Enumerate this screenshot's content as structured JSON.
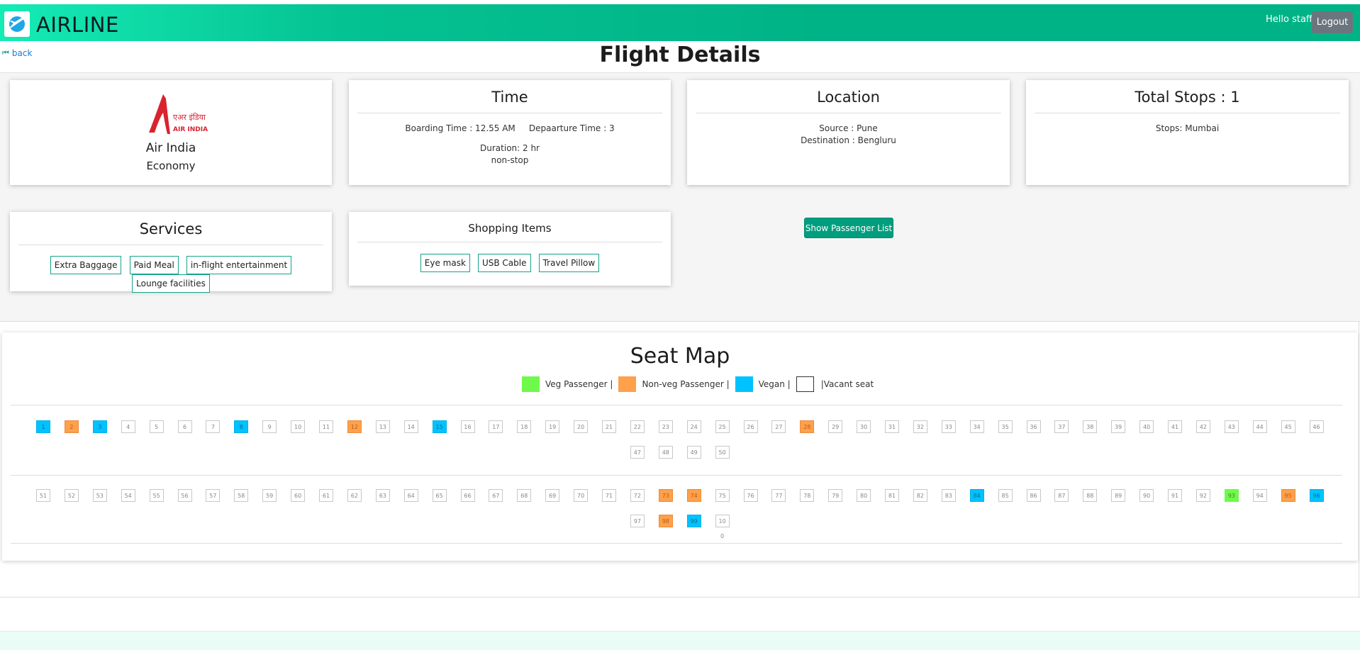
{
  "header": {
    "brand": "AIRLINE",
    "brand_icon": "airplane-icon",
    "greeting": "Hello staff",
    "logout_label": "Logout",
    "gradient_start": "#15ebb5",
    "gradient_end": "#00b386"
  },
  "nav": {
    "back_label": "back",
    "back_icon": "step-back-icon"
  },
  "page_title": "Flight Details",
  "airline_card": {
    "name": "Air India",
    "class": "Economy",
    "logo": "air-india-logo"
  },
  "time_card": {
    "title": "Time",
    "boarding": "Boarding Time : 12.55 AM",
    "departure": "Depaarture Time : 3",
    "duration": "Duration: 2 hr",
    "stop_type": "non-stop"
  },
  "location_card": {
    "title": "Location",
    "source": "Source : Pune",
    "destination": "Destination : Bengluru"
  },
  "stops_card": {
    "title": "Total Stops : 1",
    "stops": "Stops: Mumbai"
  },
  "services_card": {
    "title": "Services",
    "items": [
      "Extra Baggage",
      "Paid Meal",
      "in-flight entertainment",
      "Lounge facilities"
    ]
  },
  "shopping_card": {
    "title": "Shopping Items",
    "items": [
      "Eye mask",
      "USB Cable",
      "Travel Pillow"
    ]
  },
  "show_passenger_button": "Show Passenger List",
  "seat_map": {
    "title": "Seat Map",
    "legend": [
      {
        "label": "Veg Passenger |",
        "type": "veg"
      },
      {
        "label": "Non-veg Passenger |",
        "type": "nonveg"
      },
      {
        "label": "Vegan |",
        "type": "vegan"
      },
      {
        "label": "|Vacant seat",
        "type": "vacant"
      }
    ],
    "colors": {
      "veg": "#6ff94a",
      "nonveg": "#ffa04a",
      "vegan": "#00c2ff",
      "vacant": "#ffffff"
    },
    "seats": [
      {
        "n": "1",
        "t": "vegan"
      },
      {
        "n": "2",
        "t": "nonveg"
      },
      {
        "n": "3",
        "t": "vegan"
      },
      {
        "n": "4",
        "t": ""
      },
      {
        "n": "5",
        "t": ""
      },
      {
        "n": "6",
        "t": ""
      },
      {
        "n": "7",
        "t": ""
      },
      {
        "n": "8",
        "t": "vegan"
      },
      {
        "n": "9",
        "t": ""
      },
      {
        "n": "10",
        "t": ""
      },
      {
        "n": "11",
        "t": ""
      },
      {
        "n": "12",
        "t": "nonveg"
      },
      {
        "n": "13",
        "t": ""
      },
      {
        "n": "14",
        "t": ""
      },
      {
        "n": "15",
        "t": "vegan"
      },
      {
        "n": "16",
        "t": ""
      },
      {
        "n": "17",
        "t": ""
      },
      {
        "n": "18",
        "t": ""
      },
      {
        "n": "19",
        "t": ""
      },
      {
        "n": "20",
        "t": ""
      },
      {
        "n": "21",
        "t": ""
      },
      {
        "n": "22",
        "t": ""
      },
      {
        "n": "23",
        "t": ""
      },
      {
        "n": "24",
        "t": ""
      },
      {
        "n": "25",
        "t": ""
      },
      {
        "n": "26",
        "t": ""
      },
      {
        "n": "27",
        "t": ""
      },
      {
        "n": "28",
        "t": "nonveg"
      },
      {
        "n": "29",
        "t": ""
      },
      {
        "n": "30",
        "t": ""
      },
      {
        "n": "31",
        "t": ""
      },
      {
        "n": "32",
        "t": ""
      },
      {
        "n": "33",
        "t": ""
      },
      {
        "n": "34",
        "t": ""
      },
      {
        "n": "35",
        "t": ""
      },
      {
        "n": "36",
        "t": ""
      },
      {
        "n": "37",
        "t": ""
      },
      {
        "n": "38",
        "t": ""
      },
      {
        "n": "39",
        "t": ""
      },
      {
        "n": "40",
        "t": ""
      },
      {
        "n": "41",
        "t": ""
      },
      {
        "n": "42",
        "t": ""
      },
      {
        "n": "43",
        "t": ""
      },
      {
        "n": "44",
        "t": ""
      },
      {
        "n": "45",
        "t": ""
      },
      {
        "n": "46",
        "t": ""
      },
      {
        "n": "47",
        "t": ""
      },
      {
        "n": "48",
        "t": ""
      },
      {
        "n": "49",
        "t": ""
      },
      {
        "n": "50",
        "t": ""
      },
      {
        "n": "51",
        "t": ""
      },
      {
        "n": "52",
        "t": ""
      },
      {
        "n": "53",
        "t": ""
      },
      {
        "n": "54",
        "t": ""
      },
      {
        "n": "55",
        "t": ""
      },
      {
        "n": "56",
        "t": ""
      },
      {
        "n": "57",
        "t": ""
      },
      {
        "n": "58",
        "t": ""
      },
      {
        "n": "59",
        "t": ""
      },
      {
        "n": "60",
        "t": ""
      },
      {
        "n": "61",
        "t": ""
      },
      {
        "n": "62",
        "t": ""
      },
      {
        "n": "63",
        "t": ""
      },
      {
        "n": "64",
        "t": ""
      },
      {
        "n": "65",
        "t": ""
      },
      {
        "n": "66",
        "t": ""
      },
      {
        "n": "67",
        "t": ""
      },
      {
        "n": "68",
        "t": ""
      },
      {
        "n": "69",
        "t": ""
      },
      {
        "n": "70",
        "t": ""
      },
      {
        "n": "71",
        "t": ""
      },
      {
        "n": "72",
        "t": ""
      },
      {
        "n": "73",
        "t": "nonveg"
      },
      {
        "n": "74",
        "t": "nonveg"
      },
      {
        "n": "75",
        "t": ""
      },
      {
        "n": "76",
        "t": ""
      },
      {
        "n": "77",
        "t": ""
      },
      {
        "n": "78",
        "t": ""
      },
      {
        "n": "79",
        "t": ""
      },
      {
        "n": "80",
        "t": ""
      },
      {
        "n": "81",
        "t": ""
      },
      {
        "n": "82",
        "t": ""
      },
      {
        "n": "83",
        "t": ""
      },
      {
        "n": "84",
        "t": "vegan"
      },
      {
        "n": "85",
        "t": ""
      },
      {
        "n": "86",
        "t": ""
      },
      {
        "n": "87",
        "t": ""
      },
      {
        "n": "88",
        "t": ""
      },
      {
        "n": "89",
        "t": ""
      },
      {
        "n": "90",
        "t": ""
      },
      {
        "n": "91",
        "t": ""
      },
      {
        "n": "92",
        "t": ""
      },
      {
        "n": "93",
        "t": "veg"
      },
      {
        "n": "94",
        "t": ""
      },
      {
        "n": "95",
        "t": "nonveg"
      },
      {
        "n": "96",
        "t": "vegan"
      },
      {
        "n": "97",
        "t": ""
      },
      {
        "n": "98",
        "t": "nonveg"
      },
      {
        "n": "99",
        "t": "vegan"
      },
      {
        "n": "10",
        "t": ""
      }
    ],
    "trailing_label": "0"
  }
}
